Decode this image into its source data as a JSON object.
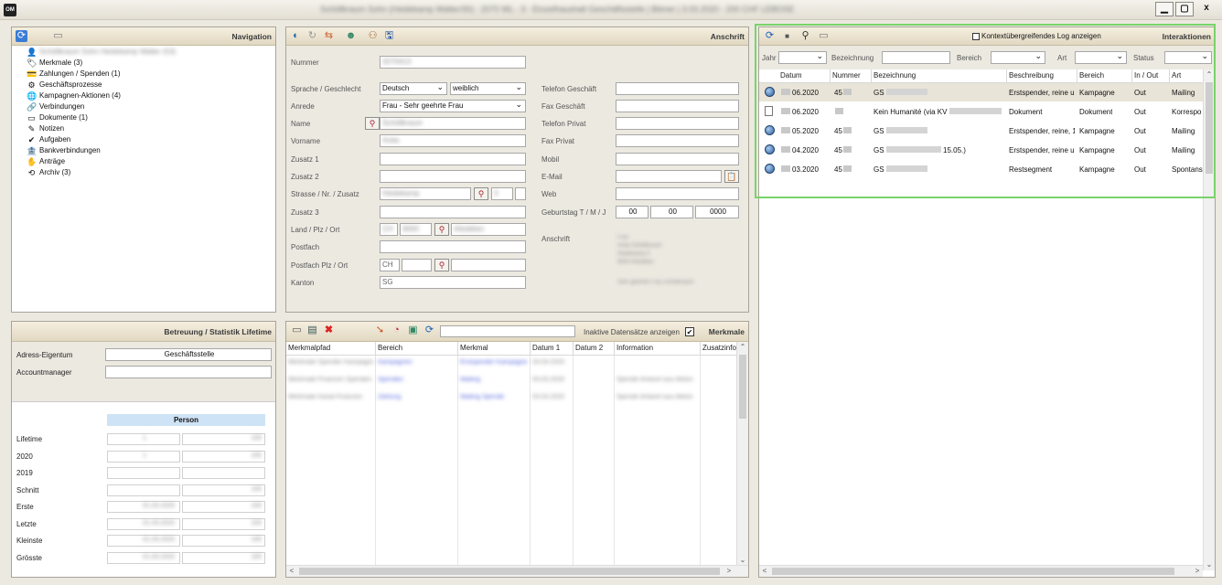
{
  "window": {
    "app_icon": "OM",
    "title": "Schöllkraum Sohn (Heidekamp Walter/30) - 2070 WL - 3 - Einzelhaushalt Geschäftsstelle | Bitmer | 3.03.2020 - 200 CHF LEBOSE",
    "minimize": "▁",
    "maximize": "▢",
    "close": "x"
  },
  "navigation": {
    "title": "Navigation",
    "root": "Schöllkraum Sohn Heidekamp Walter (53)",
    "items": [
      {
        "label": "Merkmale (3)",
        "icon": "tag-icon"
      },
      {
        "label": "Zahlungen / Spenden (1)",
        "icon": "payment-icon"
      },
      {
        "label": "Geschäftsprozesse",
        "icon": "process-icon"
      },
      {
        "label": "Kampagnen-Aktionen (4)",
        "icon": "globe-icon"
      },
      {
        "label": "Verbindungen",
        "icon": "link-icon"
      },
      {
        "label": "Dokumente (1)",
        "icon": "document-icon"
      },
      {
        "label": "Notizen",
        "icon": "note-icon"
      },
      {
        "label": "Aufgaben",
        "icon": "task-icon"
      },
      {
        "label": "Bankverbindungen",
        "icon": "bank-icon"
      },
      {
        "label": "Anträge",
        "icon": "request-icon"
      },
      {
        "label": "Archiv (3)",
        "icon": "archive-icon"
      }
    ]
  },
  "address": {
    "title": "Anschrift",
    "nummer_label": "Nummer",
    "nummer_value": "3270413",
    "sprache_label": "Sprache / Geschlecht",
    "sprache_value": "Deutsch",
    "geschlecht_value": "weiblich",
    "anrede_label": "Anrede",
    "anrede_value": "Frau - Sehr geehrte Frau",
    "name_label": "Name",
    "name_value": "Schöllkraum",
    "vorname_label": "Vorname",
    "vorname_value": "Anita",
    "zusatz1_label": "Zusatz 1",
    "zusatz2_label": "Zusatz 2",
    "strasse_label": "Strasse / Nr. / Zusatz",
    "strasse_value": "Heidekamp",
    "hausnr_value": "3",
    "zusatz3_label": "Zusatz 3",
    "land_label": "Land / Plz / Ort",
    "land_value": "CH",
    "plz_value": "9000",
    "ort_value": "Altstätten",
    "postfach_label": "Postfach",
    "postfach_plz_label": "Postfach Plz / Ort",
    "postfach_land_value": "CH",
    "kanton_label": "Kanton",
    "kanton_value": "SG",
    "tel_geschaeft_label": "Telefon Geschäft",
    "fax_geschaeft_label": "Fax Geschäft",
    "tel_privat_label": "Telefon Privat",
    "fax_privat_label": "Fax Privat",
    "mobil_label": "Mobil",
    "email_label": "E-Mail",
    "web_label": "Web",
    "geburtstag_label": "Geburtstag T / M / J",
    "geb_t": "00",
    "geb_m": "00",
    "geb_j": "0000",
    "anschrift_label": "Anschrift",
    "anschrift_lines": [
      "Frau",
      "Anita Schöllkraum",
      "Heidekamp 3",
      "9000 Altstätten"
    ],
    "anrede_line": "Sehr geehrte Frau Schöllkraum"
  },
  "interactions": {
    "title": "Interaktionen",
    "log_label": "Kontextübergreifendes Log anzeigen",
    "filter": {
      "jahr": "Jahr",
      "bezeichnung": "Bezeichnung",
      "bereich": "Bereich",
      "art": "Art",
      "status": "Status"
    },
    "columns": [
      "Datum",
      "Nummer",
      "Bezeichnung",
      "Beschreibung",
      "Bereich",
      "In / Out",
      "Art"
    ],
    "rows": [
      {
        "icon": "globe-icon",
        "datum": "06.2020",
        "nummer": "45",
        "bezeichnung": "GS",
        "beschreibung": "Erstspender, reine u",
        "bereich": "Kampagne",
        "inout": "Out",
        "art": "Mailing",
        "selected": true
      },
      {
        "icon": "document-icon",
        "datum": "06.2020",
        "nummer": "",
        "bezeichnung": "Kein Humanité (via KV",
        "bezeichnung2": "gemeldet)",
        "beschreibung": "Dokument",
        "bereich": "Dokument",
        "inout": "Out",
        "art": "Korrespo",
        "selected": false
      },
      {
        "icon": "globe-icon",
        "datum": "05.2020",
        "nummer": "45",
        "bezeichnung": "GS",
        "beschreibung": "Erstspender, reine, 1",
        "bereich": "Kampagne",
        "inout": "Out",
        "art": "Mailing",
        "selected": false
      },
      {
        "icon": "globe-icon",
        "datum": "04.2020",
        "nummer": "45",
        "bezeichnung": "GS",
        "bezeichnung2": "15.05.)",
        "beschreibung": "Erstspender, reine u",
        "bereich": "Kampagne",
        "inout": "Out",
        "art": "Mailing",
        "selected": false
      },
      {
        "icon": "globe-icon",
        "datum": "03.2020",
        "nummer": "45",
        "bezeichnung": "GS",
        "beschreibung": "Restsegment",
        "bereich": "Kampagne",
        "inout": "Out",
        "art": "Spontans",
        "selected": false
      }
    ]
  },
  "betreuung": {
    "title": "Betreuung / Statistik Lifetime",
    "adress_eigentum_label": "Adress-Eigentum",
    "adress_eigentum_value": "Geschäftsstelle",
    "accountmanager_label": "Accountmanager",
    "person_header": "Person",
    "stats": [
      {
        "label": "Lifetime",
        "a": "1",
        "b": "100"
      },
      {
        "label": "2020",
        "a": "1",
        "b": "100"
      },
      {
        "label": "2019",
        "a": "",
        "b": ""
      },
      {
        "label": "Schnitt",
        "a": "",
        "b": "100"
      },
      {
        "label": "Erste",
        "a": "01.03.2020",
        "b": "100"
      },
      {
        "label": "Letzte",
        "a": "01.03.2020",
        "b": "100"
      },
      {
        "label": "Kleinste",
        "a": "01.03.2020",
        "b": "100"
      },
      {
        "label": "Grösste",
        "a": "01.03.2020",
        "b": "100"
      }
    ]
  },
  "merkmale": {
    "title": "Merkmale",
    "inactive_label": "Inaktive Datensätze anzeigen",
    "columns": [
      "Merkmalpfad",
      "Bereich",
      "Merkmal",
      "Datum 1",
      "Datum 2",
      "Information",
      "Zusatzinfo"
    ],
    "rows": [
      {
        "pfad": "Merkmale Spender Kampagnen",
        "bereich": "Kampagnen",
        "merkmal": "Erstspender Kampagne",
        "datum1": "03.03.2020",
        "datum2": "",
        "info": ""
      },
      {
        "pfad": "Merkmale Finanzen Spenden",
        "bereich": "Spenden",
        "merkmal": "Mailing",
        "datum1": "03.03.2020",
        "datum2": "",
        "info": "Spende Antwort aus Aktion"
      },
      {
        "pfad": "Merkmale Kanal Finanzen",
        "bereich": "Zahlung",
        "merkmal": "Mailing Spende",
        "datum1": "03.03.2020",
        "datum2": "",
        "info": "Spende Antwort aus Aktion"
      }
    ]
  }
}
